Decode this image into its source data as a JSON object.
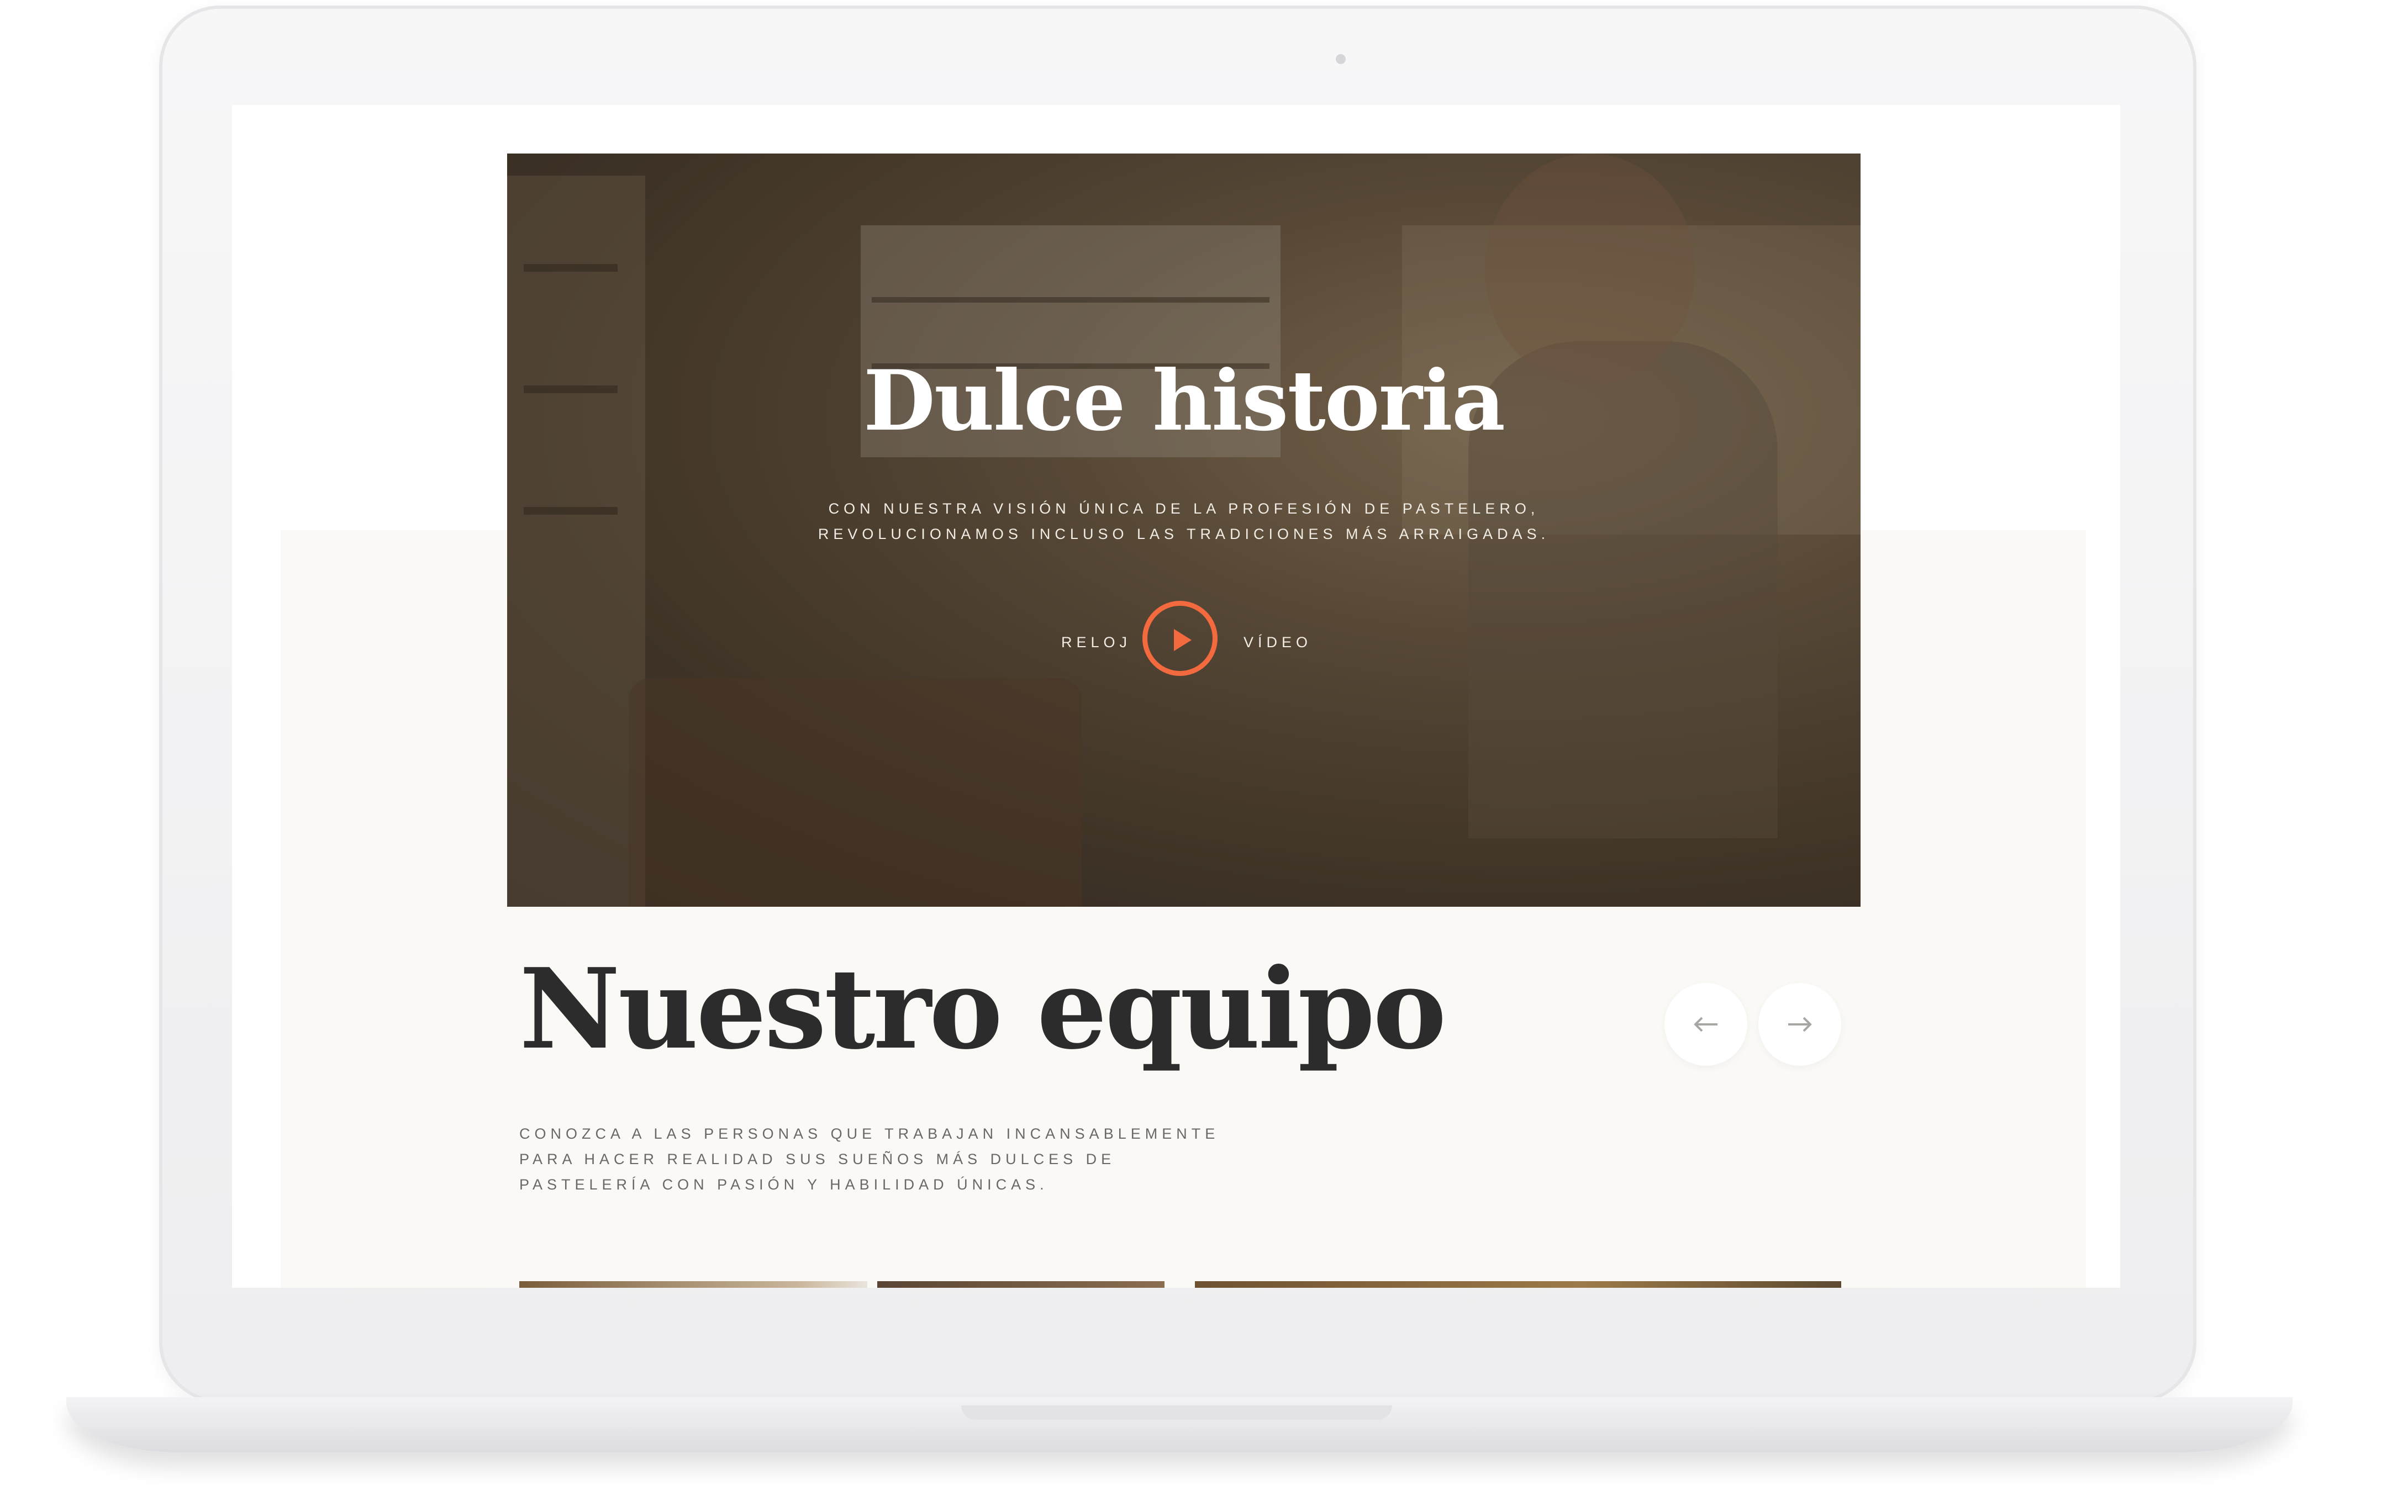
{
  "hero": {
    "title": "Dulce historia",
    "subtitle": "CON NUESTRA VISIÓN ÚNICA DE LA PROFESIÓN DE PASTELERO, REVOLUCIONAMOS INCLUSO LAS TRADICIONES MÁS ARRAIGADAS.",
    "watch_label": "RELOJ",
    "video_label": "VÍDEO",
    "play_icon": "play-icon",
    "accent_color": "#f26a3e"
  },
  "team": {
    "title": "Nuestro equipo",
    "description": "CONOZCA A LAS PERSONAS QUE TRABAJAN INCANSABLEMENTE PARA HACER REALIDAD SUS SUEÑOS MÁS DULCES DE PASTELERÍA CON PASIÓN Y HABILIDAD ÚNICAS.",
    "prev_icon": "arrow-left-icon",
    "next_icon": "arrow-right-icon"
  },
  "colors": {
    "background_cream": "#faf9f5",
    "heading": "#2d2c2c",
    "body_text": "#6a6866"
  }
}
